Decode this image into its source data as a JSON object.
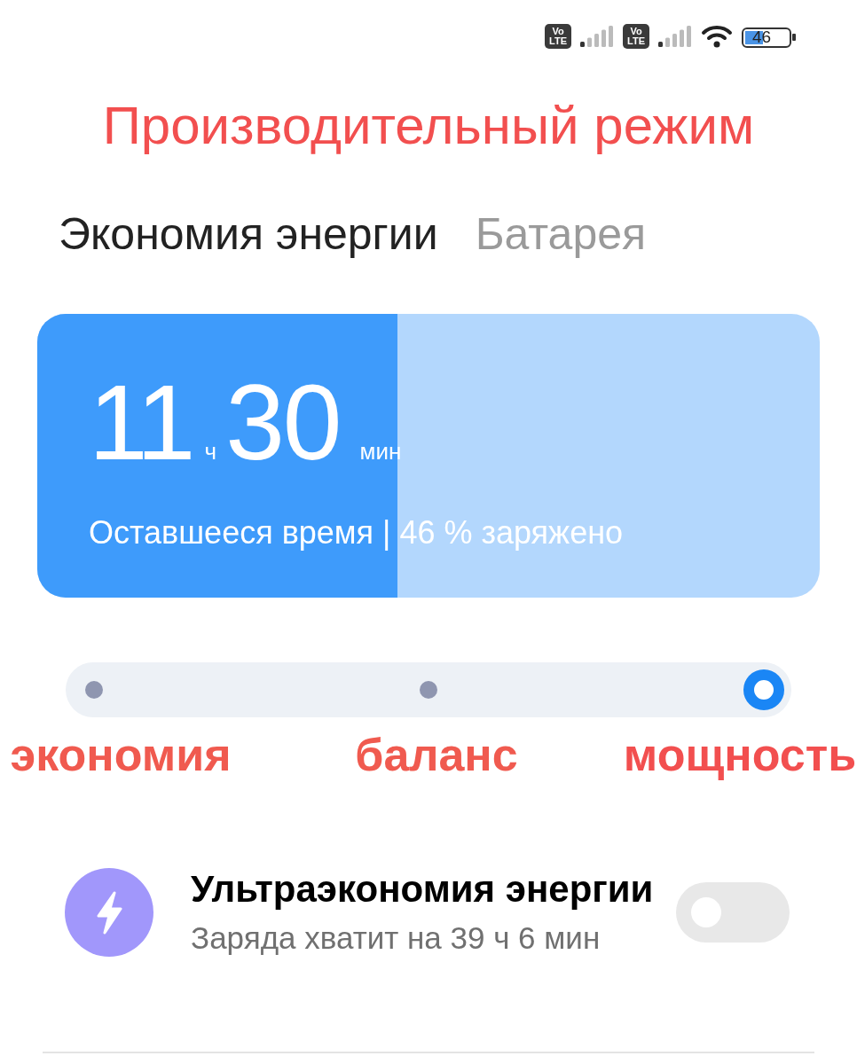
{
  "status_bar": {
    "sims": [
      {
        "badge_top": "Vo",
        "badge_bottom": "LTE"
      },
      {
        "badge_top": "Vo",
        "badge_bottom": "LTE"
      }
    ],
    "battery": "46"
  },
  "title": "Производительный режим",
  "tabs": [
    {
      "label": "Экономия энергии",
      "selected": true
    },
    {
      "label": "Батарея",
      "selected": false
    }
  ],
  "summary": {
    "hours": "11",
    "hours_unit": "ч",
    "minutes": "30",
    "minutes_unit": "мин",
    "caption": "Оставшееся время | 46 % заряжено",
    "level": 0.46
  },
  "modes": [
    {
      "label": "экономия",
      "selected": false
    },
    {
      "label": "баланс",
      "selected": false
    },
    {
      "label": "мощность",
      "selected": true
    }
  ],
  "ultra_saver": {
    "title": "Ультраэкономия энергии",
    "subtitle": "Заряда хватит на 39 ч 6 мин",
    "on": false
  }
}
